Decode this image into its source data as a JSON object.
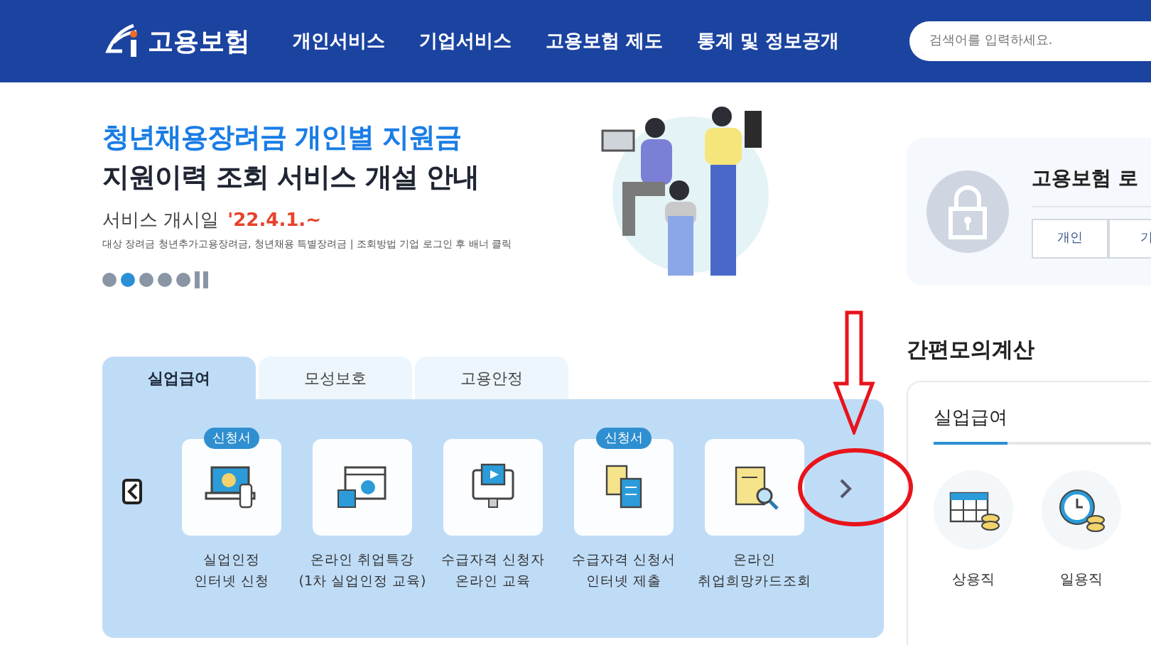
{
  "header": {
    "logo": "고용보험",
    "nav": [
      "개인서비스",
      "기업서비스",
      "고용보험 제도",
      "통계 및 정보공개"
    ],
    "search": {
      "placeholder": "검색어를 입력하세요."
    }
  },
  "banner": {
    "title_line1": "청년채용장려금 개인별 지원금",
    "title_line2": "지원이력 조회 서비스 개설 안내",
    "start_label": "서비스 개시일",
    "start_date": "'22.4.1.~",
    "note": "대상 장려금 청년추가고용장려금, 청년채용 특별장려금 | 조회방법 기업 로그인 후 배너 클릭",
    "dots": [
      {
        "selected": false
      },
      {
        "selected": true
      },
      {
        "selected": false
      },
      {
        "selected": false
      },
      {
        "selected": false
      }
    ]
  },
  "tabs": [
    {
      "label": "실업급여",
      "selected": true
    },
    {
      "label": "모성보호",
      "selected": false
    },
    {
      "label": "고용안정",
      "selected": false
    }
  ],
  "services": [
    {
      "kind": "laptop",
      "badge": "신청서",
      "lines": [
        "실업인정",
        "인터넷 신청"
      ]
    },
    {
      "kind": "browser",
      "lines": [
        "온라인 취업특강",
        "(1차 실업인정 교육)"
      ]
    },
    {
      "kind": "monitor",
      "lines": [
        "수급자격 신청자",
        "온라인 교육"
      ]
    },
    {
      "kind": "documents",
      "badge": "신청서",
      "lines": [
        "수급자격 신청서",
        "인터넷 제출"
      ]
    },
    {
      "kind": "magnifier",
      "lines": [
        "온라인",
        "취업희망카드조회"
      ]
    }
  ],
  "login": {
    "title": "고용보험 로",
    "buttons": [
      "개인",
      "기"
    ]
  },
  "calculator": {
    "heading": "간편모의계산",
    "tabs": [
      {
        "label": "실업급여",
        "selected": true
      }
    ],
    "items": [
      {
        "kind": "calendar",
        "label": "상용직"
      },
      {
        "kind": "clock",
        "label": "일용직"
      }
    ]
  }
}
